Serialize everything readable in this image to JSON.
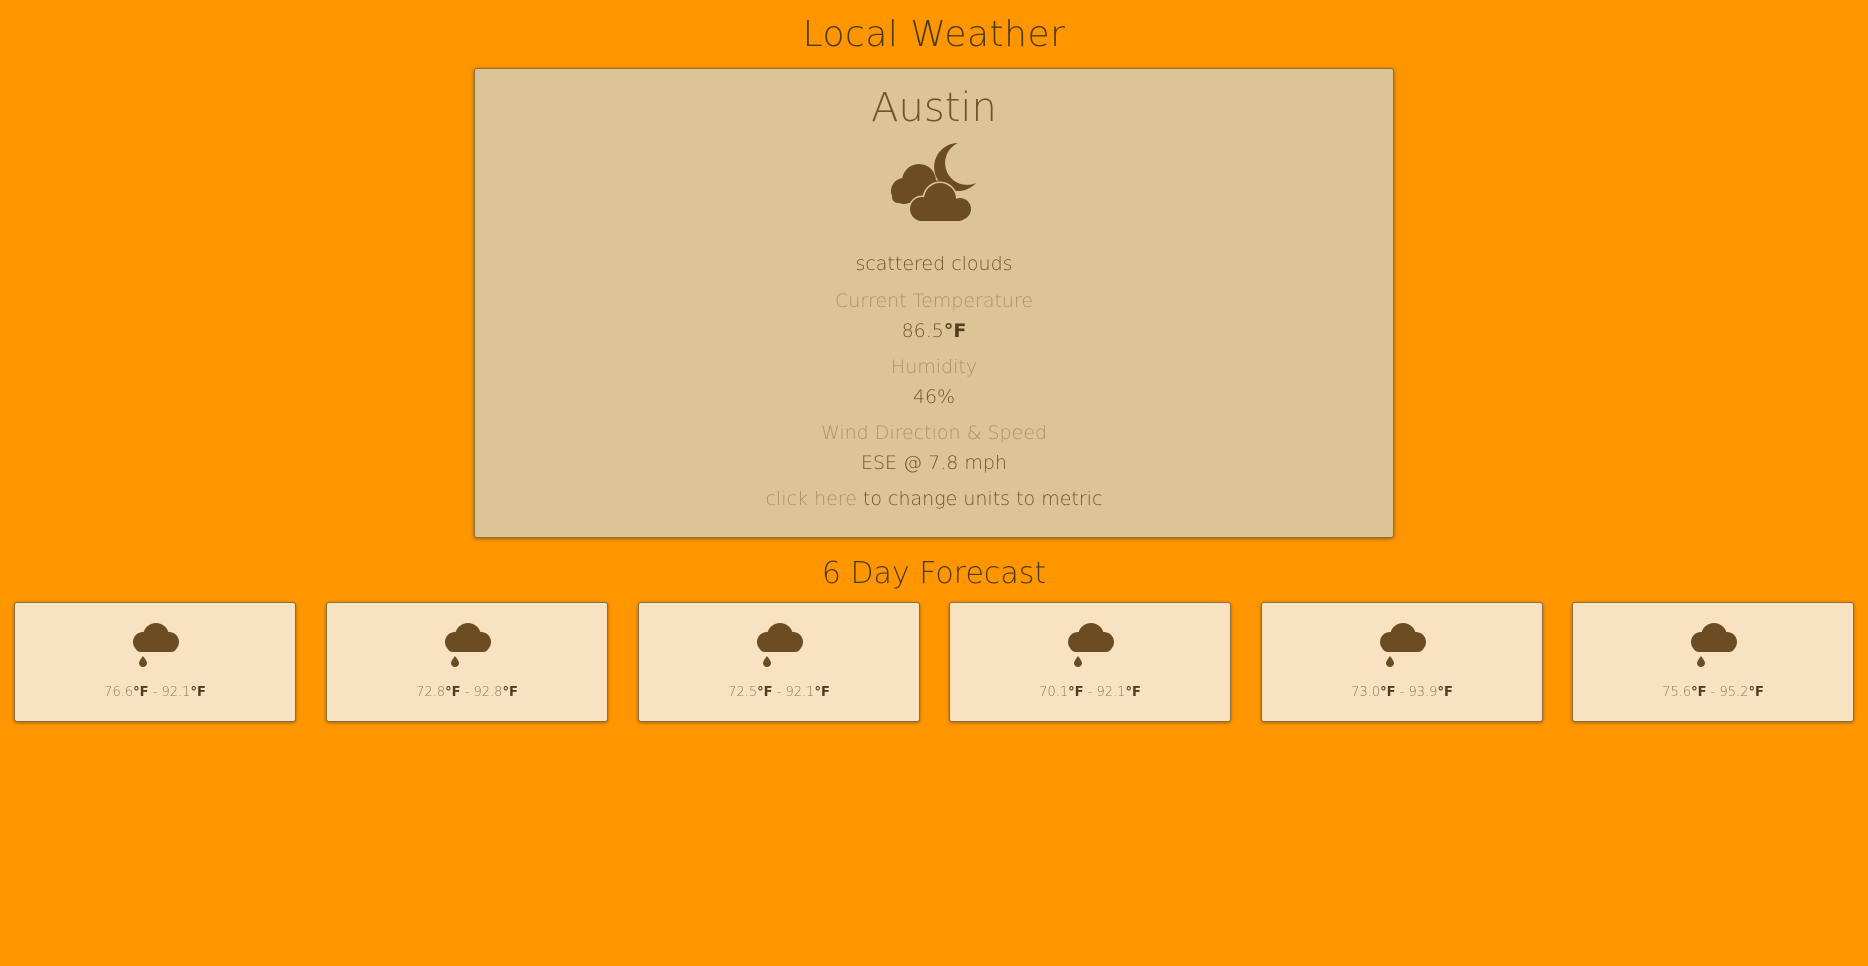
{
  "header": {
    "title": "Local Weather"
  },
  "current": {
    "city": "Austin",
    "icon": "scattered-clouds-night-icon",
    "summary": "scattered clouds",
    "temperature_label": "Current Temperature",
    "temperature_value": "86.5",
    "temperature_unit": "°F",
    "humidity_label": "Humidity",
    "humidity_value": "46%",
    "wind_label": "Wind Direction & Speed",
    "wind_value": "ESE @ 7.8 mph",
    "units_link": "click here",
    "units_text": " to change units to metric"
  },
  "forecast": {
    "title": "6 Day Forecast",
    "unit": "°F",
    "separator": " - ",
    "days": [
      {
        "icon": "rain-icon",
        "low": "76.6",
        "high": "92.1"
      },
      {
        "icon": "rain-icon",
        "low": "72.8",
        "high": "92.8"
      },
      {
        "icon": "rain-icon",
        "low": "72.5",
        "high": "92.1"
      },
      {
        "icon": "rain-icon",
        "low": "70.1",
        "high": "92.1"
      },
      {
        "icon": "rain-icon",
        "low": "73.0",
        "high": "93.9"
      },
      {
        "icon": "rain-icon",
        "low": "75.6",
        "high": "95.2"
      }
    ]
  },
  "colors": {
    "background": "#ff9600",
    "current_card": "#ddc497",
    "forecast_card": "#f9e2c2",
    "icon": "#6b4c23"
  }
}
